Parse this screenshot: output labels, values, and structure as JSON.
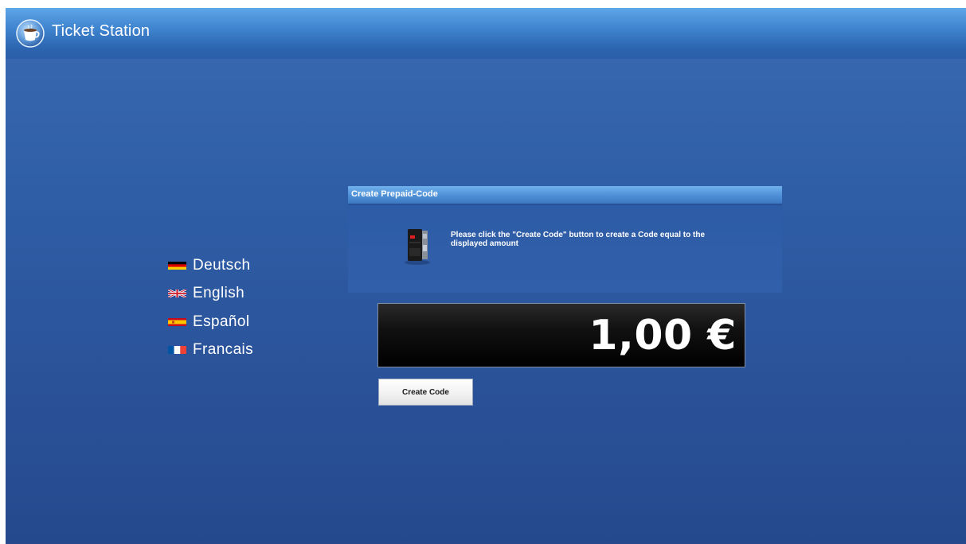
{
  "app": {
    "title": "Ticket Station",
    "logo_icon": "coffee-cup-icon"
  },
  "languages": [
    {
      "label": "Deutsch",
      "flag_icon": "flag-germany-icon"
    },
    {
      "label": "English",
      "flag_icon": "flag-uk-icon"
    },
    {
      "label": "Español",
      "flag_icon": "flag-spain-icon"
    },
    {
      "label": "Francais",
      "flag_icon": "flag-france-icon"
    }
  ],
  "panel": {
    "title": "Create Prepaid-Code",
    "instruction": "Please click the \"Create Code\" button to create a Code equal to the displayed amount",
    "icon": "ticket-terminal-icon",
    "amount": "1,00 €",
    "button_label": "Create Code"
  },
  "colors": {
    "background": "#2f5ea6",
    "titlebar": "#3f84cf",
    "panel_header": "#4d8fd6",
    "display_bg": "#000000",
    "text": "#ffffff"
  }
}
